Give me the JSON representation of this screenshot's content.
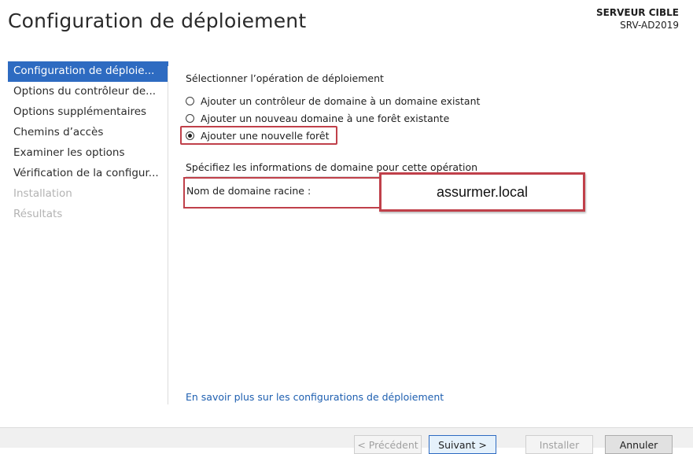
{
  "header": {
    "title": "Configuration de déploiement",
    "target_label": "SERVEUR CIBLE",
    "target_server": "SRV-AD2019"
  },
  "sidebar": {
    "items": [
      {
        "label": "Configuration de déploie..."
      },
      {
        "label": "Options du contrôleur de..."
      },
      {
        "label": "Options supplémentaires"
      },
      {
        "label": "Chemins d’accès"
      },
      {
        "label": "Examiner les options"
      },
      {
        "label": "Vérification de la configur..."
      },
      {
        "label": "Installation"
      },
      {
        "label": "Résultats"
      }
    ]
  },
  "main": {
    "operation_label": "Sélectionner l’opération de déploiement",
    "options": [
      {
        "label": "Ajouter un contrôleur de domaine à un domaine existant",
        "selected": false
      },
      {
        "label": "Ajouter un nouveau domaine à une forêt existante",
        "selected": false
      },
      {
        "label": "Ajouter une nouvelle forêt",
        "selected": true
      }
    ],
    "domain_info_label": "Spécifiez les informations de domaine pour cette opération",
    "root_domain_label": "Nom de domaine racine :",
    "root_domain_value": "assurmer.local",
    "learn_more_link": "En savoir plus sur les configurations de déploiement"
  },
  "footer": {
    "previous": "< Précédent",
    "next": "Suivant >",
    "install": "Installer",
    "cancel": "Annuler"
  },
  "colors": {
    "accent": "#2e6bc1",
    "highlight_box": "#c0404a",
    "link": "#1e5fb0"
  }
}
